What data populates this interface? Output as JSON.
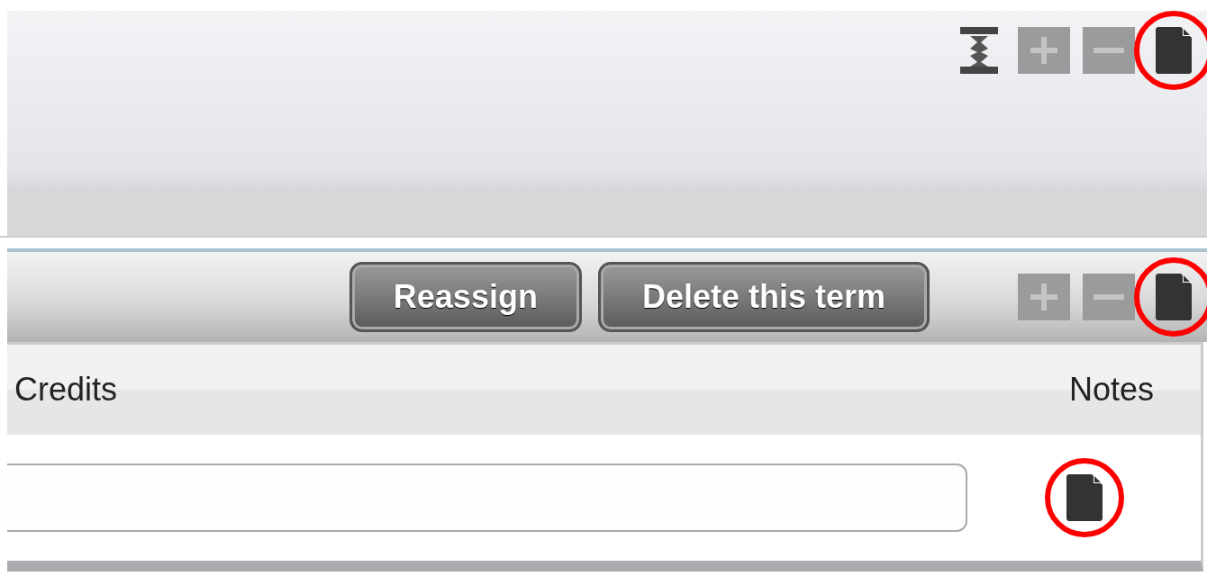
{
  "top_panel": {
    "tools": [
      {
        "kind": "collapse",
        "disabled": false,
        "highlighted": false
      },
      {
        "kind": "add",
        "disabled": true,
        "highlighted": false
      },
      {
        "kind": "remove",
        "disabled": true,
        "highlighted": false
      },
      {
        "kind": "note",
        "disabled": false,
        "highlighted": true
      }
    ]
  },
  "term_panel": {
    "buttons": [
      "Reassign",
      "Delete this term"
    ],
    "tools": [
      {
        "kind": "add",
        "disabled": true,
        "highlighted": false
      },
      {
        "kind": "remove",
        "disabled": true,
        "highlighted": false
      },
      {
        "kind": "note",
        "disabled": false,
        "highlighted": true
      }
    ],
    "table": {
      "columns": [
        "Credits",
        "Notes"
      ],
      "rows": [
        {
          "note_highlighted": true
        }
      ]
    }
  }
}
